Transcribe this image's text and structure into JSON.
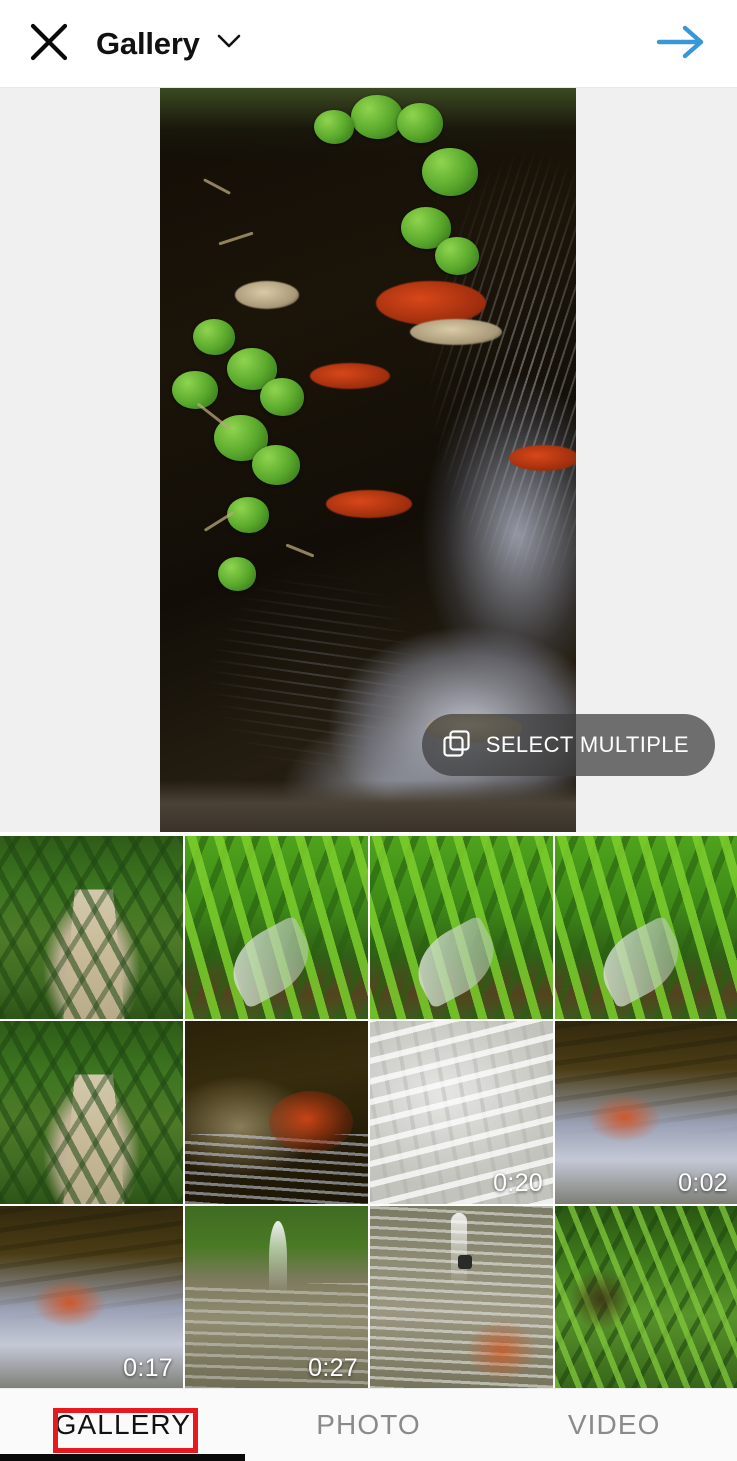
{
  "header": {
    "close_icon": "close-icon",
    "title": "Gallery",
    "dropdown_icon": "chevron-down-icon",
    "next_icon": "arrow-right-icon",
    "next_color": "#3897d8"
  },
  "preview": {
    "description": "koi-pond-photo",
    "select_multiple": {
      "label": "SELECT MULTIPLE",
      "icon": "stacked-squares-icon"
    }
  },
  "grid": {
    "items": [
      {
        "scene": "sc-path",
        "name": "thumbnail-garden-path-1",
        "duration": ""
      },
      {
        "scene": "sc-leaf",
        "name": "thumbnail-foliage-1",
        "duration": ""
      },
      {
        "scene": "sc-leaf",
        "name": "thumbnail-foliage-2",
        "duration": ""
      },
      {
        "scene": "sc-leaf",
        "name": "thumbnail-foliage-3",
        "duration": ""
      },
      {
        "scene": "sc-path",
        "name": "thumbnail-garden-path-2",
        "duration": ""
      },
      {
        "scene": "sc-koi",
        "name": "thumbnail-koi-pond",
        "duration": ""
      },
      {
        "scene": "sc-pale",
        "name": "thumbnail-video-water-pale",
        "duration": "0:20"
      },
      {
        "scene": "sc-reflect",
        "name": "thumbnail-video-koi-reflect",
        "duration": "0:02"
      },
      {
        "scene": "sc-reflect",
        "name": "thumbnail-video-koi-sky",
        "duration": "0:17"
      },
      {
        "scene": "sc-fount",
        "name": "thumbnail-video-fountain",
        "duration": "0:27"
      },
      {
        "scene": "sc-ripple",
        "name": "thumbnail-pond-ripples",
        "duration": ""
      },
      {
        "scene": "sc-green",
        "name": "thumbnail-greenery",
        "duration": ""
      }
    ]
  },
  "tabs": {
    "items": [
      {
        "label": "GALLERY",
        "active": true,
        "highlighted": true
      },
      {
        "label": "PHOTO",
        "active": false,
        "highlighted": false
      },
      {
        "label": "VIDEO",
        "active": false,
        "highlighted": false
      }
    ],
    "highlight_color": "#e8191e",
    "indicator_color": "#0a0a0a"
  }
}
